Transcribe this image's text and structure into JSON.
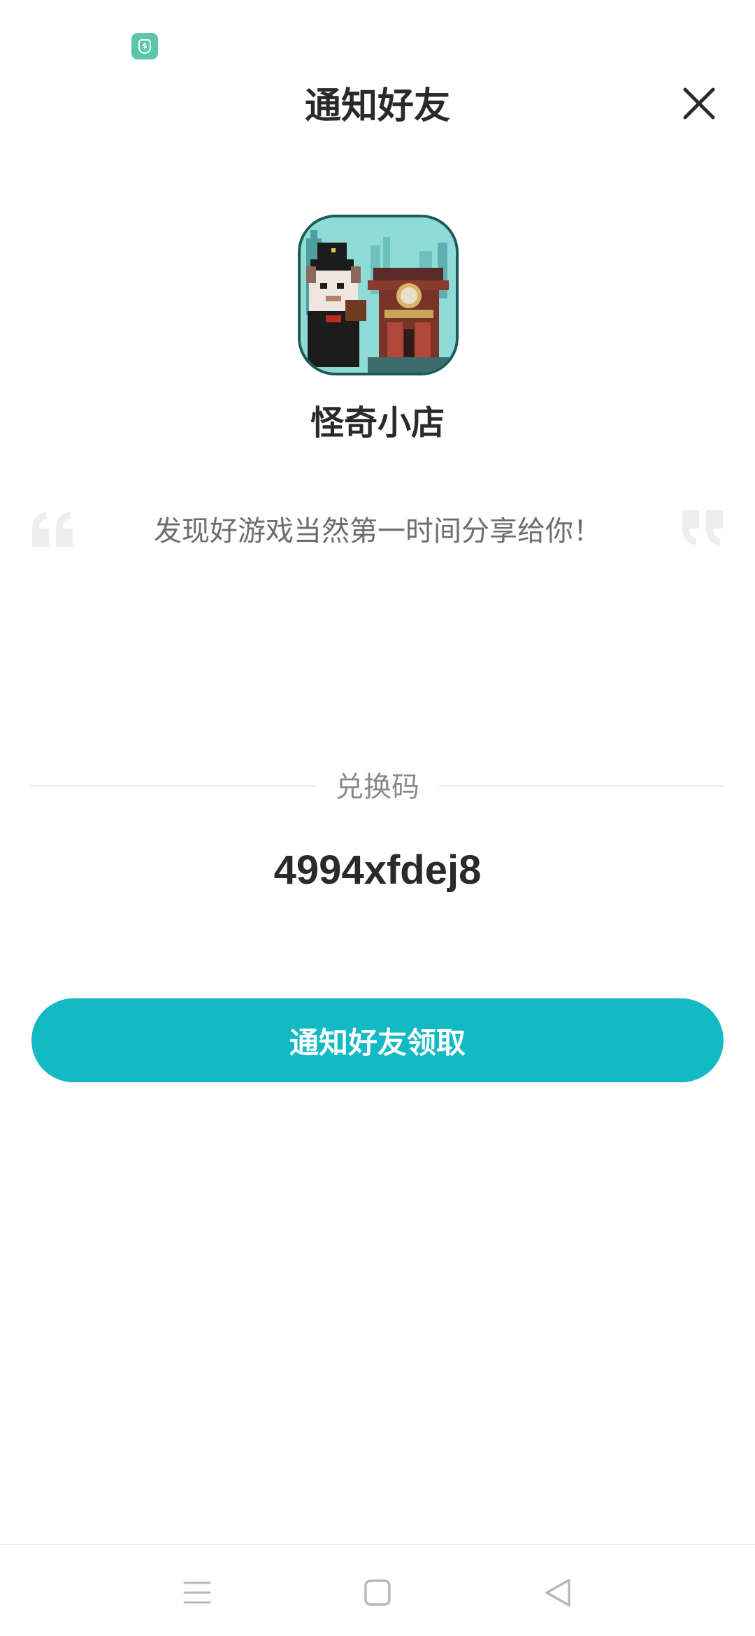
{
  "status_bar": {
    "badge_icon": "shield-dollar-icon",
    "badge_symbol": "$",
    "badge_color": "#5bc7a7"
  },
  "header": {
    "title": "通知好友",
    "close_icon": "close-icon"
  },
  "app": {
    "icon": "pixel-art-shop-game-icon",
    "name": "怪奇小店"
  },
  "share": {
    "open_quote_icon": "open-quote-icon",
    "close_quote_icon": "close-quote-icon",
    "message": "发现好游戏当然第一时间分享给你！"
  },
  "redeem": {
    "label": "兑换码",
    "code": "4994xfdej8"
  },
  "action": {
    "button_label": "通知好友领取",
    "button_color": "#14b9c6"
  },
  "nav_bar": {
    "menu_icon": "menu-icon",
    "home_icon": "home-square-icon",
    "back_icon": "back-triangle-icon"
  }
}
